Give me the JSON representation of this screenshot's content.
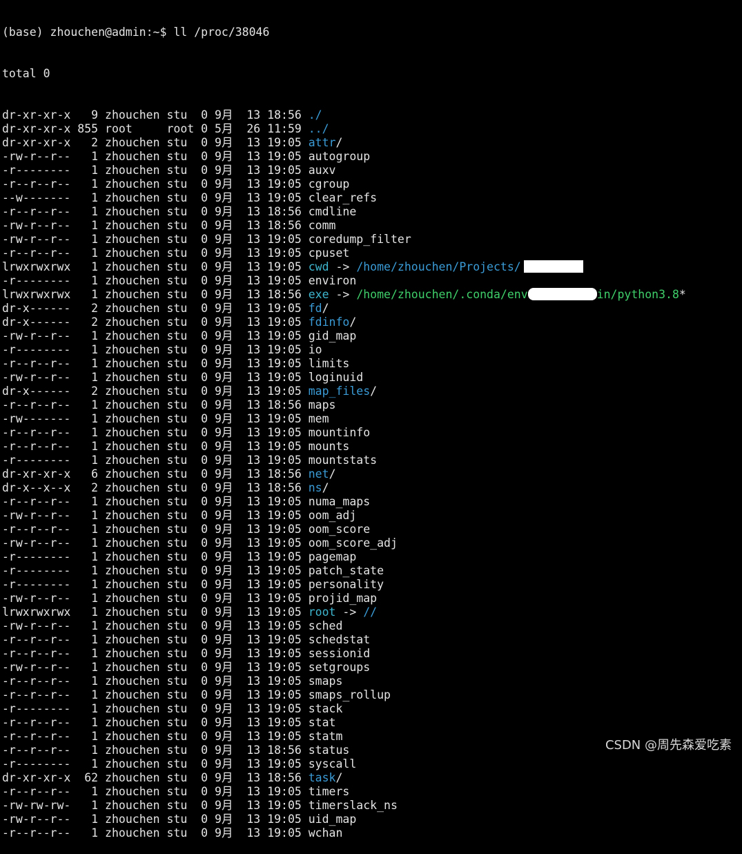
{
  "prompt_line": "(base) zhouchen@admin:~$ ll /proc/38046",
  "total_line": "total 0",
  "colors": {
    "background": "#000000",
    "text": "#e4e4e4",
    "directory": "#3a9bd6",
    "symlink": "#3eb6cf",
    "executable": "#3fcf6a",
    "redaction": "#ffffff"
  },
  "entries": [
    {
      "perm": "dr-xr-xr-x",
      "links": "  9",
      "owner": "zhouchen",
      "group": "stu ",
      "size": "0",
      "month": "9月",
      "day": " 13",
      "time": "18:56",
      "name": "./",
      "kind": "dir"
    },
    {
      "perm": "dr-xr-xr-x",
      "links": "855",
      "owner": "root    ",
      "group": "root",
      "size": "0",
      "month": "5月",
      "day": " 26",
      "time": "11:59",
      "name": "../",
      "kind": "dir"
    },
    {
      "perm": "dr-xr-xr-x",
      "links": "  2",
      "owner": "zhouchen",
      "group": "stu ",
      "size": "0",
      "month": "9月",
      "day": " 13",
      "time": "19:05",
      "name": "attr",
      "kind": "dir"
    },
    {
      "perm": "-rw-r--r--",
      "links": "  1",
      "owner": "zhouchen",
      "group": "stu ",
      "size": "0",
      "month": "9月",
      "day": " 13",
      "time": "19:05",
      "name": "autogroup",
      "kind": "file"
    },
    {
      "perm": "-r--------",
      "links": "  1",
      "owner": "zhouchen",
      "group": "stu ",
      "size": "0",
      "month": "9月",
      "day": " 13",
      "time": "19:05",
      "name": "auxv",
      "kind": "file"
    },
    {
      "perm": "-r--r--r--",
      "links": "  1",
      "owner": "zhouchen",
      "group": "stu ",
      "size": "0",
      "month": "9月",
      "day": " 13",
      "time": "19:05",
      "name": "cgroup",
      "kind": "file"
    },
    {
      "perm": "--w-------",
      "links": "  1",
      "owner": "zhouchen",
      "group": "stu ",
      "size": "0",
      "month": "9月",
      "day": " 13",
      "time": "19:05",
      "name": "clear_refs",
      "kind": "file"
    },
    {
      "perm": "-r--r--r--",
      "links": "  1",
      "owner": "zhouchen",
      "group": "stu ",
      "size": "0",
      "month": "9月",
      "day": " 13",
      "time": "18:56",
      "name": "cmdline",
      "kind": "file"
    },
    {
      "perm": "-rw-r--r--",
      "links": "  1",
      "owner": "zhouchen",
      "group": "stu ",
      "size": "0",
      "month": "9月",
      "day": " 13",
      "time": "18:56",
      "name": "comm",
      "kind": "file"
    },
    {
      "perm": "-rw-r--r--",
      "links": "  1",
      "owner": "zhouchen",
      "group": "stu ",
      "size": "0",
      "month": "9月",
      "day": " 13",
      "time": "19:05",
      "name": "coredump_filter",
      "kind": "file"
    },
    {
      "perm": "-r--r--r--",
      "links": "  1",
      "owner": "zhouchen",
      "group": "stu ",
      "size": "0",
      "month": "9月",
      "day": " 13",
      "time": "19:05",
      "name": "cpuset",
      "kind": "file"
    },
    {
      "perm": "lrwxrwxrwx",
      "links": "  1",
      "owner": "zhouchen",
      "group": "stu ",
      "size": "0",
      "month": "9月",
      "day": " 13",
      "time": "19:05",
      "name": "cwd",
      "kind": "link",
      "target": "/home/zhouchen/Projects/",
      "target_kind": "dir",
      "redact": "cwd"
    },
    {
      "perm": "-r--------",
      "links": "  1",
      "owner": "zhouchen",
      "group": "stu ",
      "size": "0",
      "month": "9月",
      "day": " 13",
      "time": "19:05",
      "name": "environ",
      "kind": "file"
    },
    {
      "perm": "lrwxrwxrwx",
      "links": "  1",
      "owner": "zhouchen",
      "group": "stu ",
      "size": "0",
      "month": "9月",
      "day": " 13",
      "time": "18:56",
      "name": "exe",
      "kind": "link",
      "target": "/home/zhouchen/.conda/env",
      "target_tail": "in/python3.8",
      "target_suffix": "*",
      "target_kind": "exe",
      "redact": "exe"
    },
    {
      "perm": "dr-x------",
      "links": "  2",
      "owner": "zhouchen",
      "group": "stu ",
      "size": "0",
      "month": "9月",
      "day": " 13",
      "time": "19:05",
      "name": "fd",
      "kind": "dir"
    },
    {
      "perm": "dr-x------",
      "links": "  2",
      "owner": "zhouchen",
      "group": "stu ",
      "size": "0",
      "month": "9月",
      "day": " 13",
      "time": "19:05",
      "name": "fdinfo",
      "kind": "dir"
    },
    {
      "perm": "-rw-r--r--",
      "links": "  1",
      "owner": "zhouchen",
      "group": "stu ",
      "size": "0",
      "month": "9月",
      "day": " 13",
      "time": "19:05",
      "name": "gid_map",
      "kind": "file"
    },
    {
      "perm": "-r--------",
      "links": "  1",
      "owner": "zhouchen",
      "group": "stu ",
      "size": "0",
      "month": "9月",
      "day": " 13",
      "time": "19:05",
      "name": "io",
      "kind": "file"
    },
    {
      "perm": "-r--r--r--",
      "links": "  1",
      "owner": "zhouchen",
      "group": "stu ",
      "size": "0",
      "month": "9月",
      "day": " 13",
      "time": "19:05",
      "name": "limits",
      "kind": "file"
    },
    {
      "perm": "-rw-r--r--",
      "links": "  1",
      "owner": "zhouchen",
      "group": "stu ",
      "size": "0",
      "month": "9月",
      "day": " 13",
      "time": "19:05",
      "name": "loginuid",
      "kind": "file"
    },
    {
      "perm": "dr-x------",
      "links": "  2",
      "owner": "zhouchen",
      "group": "stu ",
      "size": "0",
      "month": "9月",
      "day": " 13",
      "time": "19:05",
      "name": "map_files",
      "kind": "dir"
    },
    {
      "perm": "-r--r--r--",
      "links": "  1",
      "owner": "zhouchen",
      "group": "stu ",
      "size": "0",
      "month": "9月",
      "day": " 13",
      "time": "18:56",
      "name": "maps",
      "kind": "file"
    },
    {
      "perm": "-rw-------",
      "links": "  1",
      "owner": "zhouchen",
      "group": "stu ",
      "size": "0",
      "month": "9月",
      "day": " 13",
      "time": "19:05",
      "name": "mem",
      "kind": "file"
    },
    {
      "perm": "-r--r--r--",
      "links": "  1",
      "owner": "zhouchen",
      "group": "stu ",
      "size": "0",
      "month": "9月",
      "day": " 13",
      "time": "19:05",
      "name": "mountinfo",
      "kind": "file"
    },
    {
      "perm": "-r--r--r--",
      "links": "  1",
      "owner": "zhouchen",
      "group": "stu ",
      "size": "0",
      "month": "9月",
      "day": " 13",
      "time": "19:05",
      "name": "mounts",
      "kind": "file"
    },
    {
      "perm": "-r--------",
      "links": "  1",
      "owner": "zhouchen",
      "group": "stu ",
      "size": "0",
      "month": "9月",
      "day": " 13",
      "time": "19:05",
      "name": "mountstats",
      "kind": "file"
    },
    {
      "perm": "dr-xr-xr-x",
      "links": "  6",
      "owner": "zhouchen",
      "group": "stu ",
      "size": "0",
      "month": "9月",
      "day": " 13",
      "time": "18:56",
      "name": "net",
      "kind": "dir"
    },
    {
      "perm": "dr-x--x--x",
      "links": "  2",
      "owner": "zhouchen",
      "group": "stu ",
      "size": "0",
      "month": "9月",
      "day": " 13",
      "time": "18:56",
      "name": "ns",
      "kind": "dir"
    },
    {
      "perm": "-r--r--r--",
      "links": "  1",
      "owner": "zhouchen",
      "group": "stu ",
      "size": "0",
      "month": "9月",
      "day": " 13",
      "time": "19:05",
      "name": "numa_maps",
      "kind": "file"
    },
    {
      "perm": "-rw-r--r--",
      "links": "  1",
      "owner": "zhouchen",
      "group": "stu ",
      "size": "0",
      "month": "9月",
      "day": " 13",
      "time": "19:05",
      "name": "oom_adj",
      "kind": "file"
    },
    {
      "perm": "-r--r--r--",
      "links": "  1",
      "owner": "zhouchen",
      "group": "stu ",
      "size": "0",
      "month": "9月",
      "day": " 13",
      "time": "19:05",
      "name": "oom_score",
      "kind": "file"
    },
    {
      "perm": "-rw-r--r--",
      "links": "  1",
      "owner": "zhouchen",
      "group": "stu ",
      "size": "0",
      "month": "9月",
      "day": " 13",
      "time": "19:05",
      "name": "oom_score_adj",
      "kind": "file"
    },
    {
      "perm": "-r--------",
      "links": "  1",
      "owner": "zhouchen",
      "group": "stu ",
      "size": "0",
      "month": "9月",
      "day": " 13",
      "time": "19:05",
      "name": "pagemap",
      "kind": "file"
    },
    {
      "perm": "-r--------",
      "links": "  1",
      "owner": "zhouchen",
      "group": "stu ",
      "size": "0",
      "month": "9月",
      "day": " 13",
      "time": "19:05",
      "name": "patch_state",
      "kind": "file"
    },
    {
      "perm": "-r--------",
      "links": "  1",
      "owner": "zhouchen",
      "group": "stu ",
      "size": "0",
      "month": "9月",
      "day": " 13",
      "time": "19:05",
      "name": "personality",
      "kind": "file"
    },
    {
      "perm": "-rw-r--r--",
      "links": "  1",
      "owner": "zhouchen",
      "group": "stu ",
      "size": "0",
      "month": "9月",
      "day": " 13",
      "time": "19:05",
      "name": "projid_map",
      "kind": "file"
    },
    {
      "perm": "lrwxrwxrwx",
      "links": "  1",
      "owner": "zhouchen",
      "group": "stu ",
      "size": "0",
      "month": "9月",
      "day": " 13",
      "time": "19:05",
      "name": "root",
      "kind": "link",
      "target": "//",
      "target_kind": "dir"
    },
    {
      "perm": "-rw-r--r--",
      "links": "  1",
      "owner": "zhouchen",
      "group": "stu ",
      "size": "0",
      "month": "9月",
      "day": " 13",
      "time": "19:05",
      "name": "sched",
      "kind": "file"
    },
    {
      "perm": "-r--r--r--",
      "links": "  1",
      "owner": "zhouchen",
      "group": "stu ",
      "size": "0",
      "month": "9月",
      "day": " 13",
      "time": "19:05",
      "name": "schedstat",
      "kind": "file"
    },
    {
      "perm": "-r--r--r--",
      "links": "  1",
      "owner": "zhouchen",
      "group": "stu ",
      "size": "0",
      "month": "9月",
      "day": " 13",
      "time": "19:05",
      "name": "sessionid",
      "kind": "file"
    },
    {
      "perm": "-rw-r--r--",
      "links": "  1",
      "owner": "zhouchen",
      "group": "stu ",
      "size": "0",
      "month": "9月",
      "day": " 13",
      "time": "19:05",
      "name": "setgroups",
      "kind": "file"
    },
    {
      "perm": "-r--r--r--",
      "links": "  1",
      "owner": "zhouchen",
      "group": "stu ",
      "size": "0",
      "month": "9月",
      "day": " 13",
      "time": "19:05",
      "name": "smaps",
      "kind": "file"
    },
    {
      "perm": "-r--r--r--",
      "links": "  1",
      "owner": "zhouchen",
      "group": "stu ",
      "size": "0",
      "month": "9月",
      "day": " 13",
      "time": "19:05",
      "name": "smaps_rollup",
      "kind": "file"
    },
    {
      "perm": "-r--------",
      "links": "  1",
      "owner": "zhouchen",
      "group": "stu ",
      "size": "0",
      "month": "9月",
      "day": " 13",
      "time": "19:05",
      "name": "stack",
      "kind": "file"
    },
    {
      "perm": "-r--r--r--",
      "links": "  1",
      "owner": "zhouchen",
      "group": "stu ",
      "size": "0",
      "month": "9月",
      "day": " 13",
      "time": "19:05",
      "name": "stat",
      "kind": "file"
    },
    {
      "perm": "-r--r--r--",
      "links": "  1",
      "owner": "zhouchen",
      "group": "stu ",
      "size": "0",
      "month": "9月",
      "day": " 13",
      "time": "19:05",
      "name": "statm",
      "kind": "file"
    },
    {
      "perm": "-r--r--r--",
      "links": "  1",
      "owner": "zhouchen",
      "group": "stu ",
      "size": "0",
      "month": "9月",
      "day": " 13",
      "time": "18:56",
      "name": "status",
      "kind": "file"
    },
    {
      "perm": "-r--------",
      "links": "  1",
      "owner": "zhouchen",
      "group": "stu ",
      "size": "0",
      "month": "9月",
      "day": " 13",
      "time": "19:05",
      "name": "syscall",
      "kind": "file"
    },
    {
      "perm": "dr-xr-xr-x",
      "links": " 62",
      "owner": "zhouchen",
      "group": "stu ",
      "size": "0",
      "month": "9月",
      "day": " 13",
      "time": "18:56",
      "name": "task",
      "kind": "dir"
    },
    {
      "perm": "-r--r--r--",
      "links": "  1",
      "owner": "zhouchen",
      "group": "stu ",
      "size": "0",
      "month": "9月",
      "day": " 13",
      "time": "19:05",
      "name": "timers",
      "kind": "file"
    },
    {
      "perm": "-rw-rw-rw-",
      "links": "  1",
      "owner": "zhouchen",
      "group": "stu ",
      "size": "0",
      "month": "9月",
      "day": " 13",
      "time": "19:05",
      "name": "timerslack_ns",
      "kind": "file"
    },
    {
      "perm": "-rw-r--r--",
      "links": "  1",
      "owner": "zhouchen",
      "group": "stu ",
      "size": "0",
      "month": "9月",
      "day": " 13",
      "time": "19:05",
      "name": "uid_map",
      "kind": "file"
    },
    {
      "perm": "-r--r--r--",
      "links": "  1",
      "owner": "zhouchen",
      "group": "stu ",
      "size": "0",
      "month": "9月",
      "day": " 13",
      "time": "19:05",
      "name": "wchan",
      "kind": "file"
    }
  ],
  "watermark": "CSDN @周先森爱吃素"
}
